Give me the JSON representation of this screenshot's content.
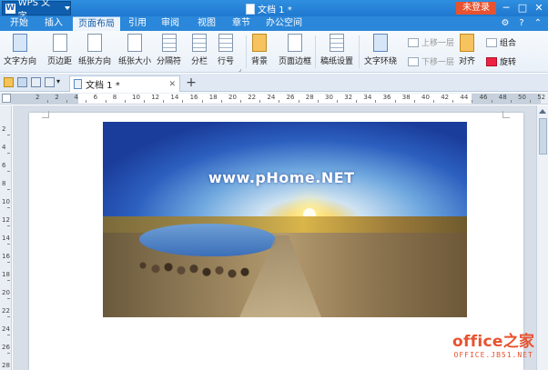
{
  "titlebar": {
    "app_button": "WPS 文字",
    "doc_title": "文档 1 *",
    "login_button": "未登录",
    "window_controls": [
      "─",
      "□",
      "✕"
    ]
  },
  "menu": {
    "tabs": [
      "开始",
      "插入",
      "页面布局",
      "引用",
      "审阅",
      "视图",
      "章节",
      "办公空间"
    ],
    "active_tab": "页面布局",
    "right_icons": [
      "gear-icon",
      "help-icon",
      "minimize-ribbon-icon"
    ]
  },
  "ribbon": {
    "buttons": [
      {
        "label": "文字方向",
        "icon": "text-direction-icon"
      },
      {
        "label": "页边距",
        "icon": "margins-icon"
      },
      {
        "label": "纸张方向",
        "icon": "orientation-icon"
      },
      {
        "label": "纸张大小",
        "icon": "paper-size-icon"
      },
      {
        "label": "分隔符",
        "icon": "separator-icon"
      },
      {
        "label": "分栏",
        "icon": "columns-icon"
      },
      {
        "label": "行号",
        "icon": "line-number-icon"
      },
      {
        "label": "背景",
        "icon": "background-icon"
      },
      {
        "label": "页面边框",
        "icon": "page-border-icon"
      },
      {
        "label": "稿纸设置",
        "icon": "manuscript-icon"
      },
      {
        "label": "文字环绕",
        "icon": "text-wrap-icon"
      },
      {
        "label": "对齐",
        "icon": "align-icon"
      },
      {
        "label": "旋转",
        "icon": "rotate-icon"
      }
    ],
    "small_buttons": {
      "bring_forward": "上移一层",
      "send_backward": "下移一层",
      "group": "组合"
    }
  },
  "quickbar": {
    "doc_tab": "文档 1 *",
    "new_tab": "+"
  },
  "ruler": {
    "h_ticks": [
      "2",
      "2",
      "4",
      "6",
      "8",
      "10",
      "12",
      "14",
      "16",
      "18",
      "20",
      "22",
      "24",
      "26",
      "28",
      "30",
      "32",
      "34",
      "36",
      "38",
      "40",
      "42",
      "44",
      "46",
      "48",
      "50",
      "52"
    ],
    "v_ticks": [
      "2",
      "4",
      "6",
      "8",
      "10",
      "12",
      "14",
      "16",
      "18",
      "20",
      "22",
      "24",
      "26",
      "28"
    ]
  },
  "document": {
    "image_watermark": "www.pHome.NET"
  },
  "site_watermark": {
    "main": "office之家",
    "sub": "OFFICE.JB51.NET"
  },
  "colors": {
    "titlebar": "#1f78cf",
    "menubar": "#2b87d9",
    "login": "#e8522f",
    "site_watermark": "#e8522f"
  }
}
